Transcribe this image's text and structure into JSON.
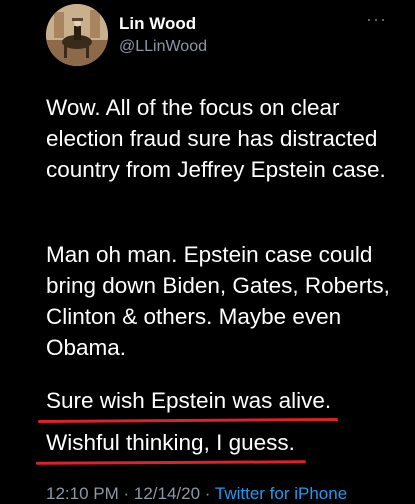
{
  "tweet": {
    "author": {
      "display_name": "Lin Wood",
      "handle": "@LLinWood",
      "avatar_icon": "profile-photo"
    },
    "more_icon": "more-options-icon",
    "paragraphs": [
      "Wow. All of the focus on clear election fraud sure has distracted country from Jeffrey Epstein case.",
      "Man oh man. Epstein case could bring down Biden, Gates, Roberts, Clinton & others. Maybe even Obama.",
      "Sure wish Epstein was alive.",
      "Wishful thinking, I guess."
    ],
    "meta": {
      "time": "12:10 PM",
      "separator1": " · ",
      "date": "12/14/20",
      "separator2": " · ",
      "source": "Twitter for iPhone"
    }
  },
  "colors": {
    "background": "#000000",
    "text": "#ffffff",
    "secondary": "#8b98a5",
    "link": "#1d9bf0",
    "annotation_underline": "#e0202a"
  }
}
